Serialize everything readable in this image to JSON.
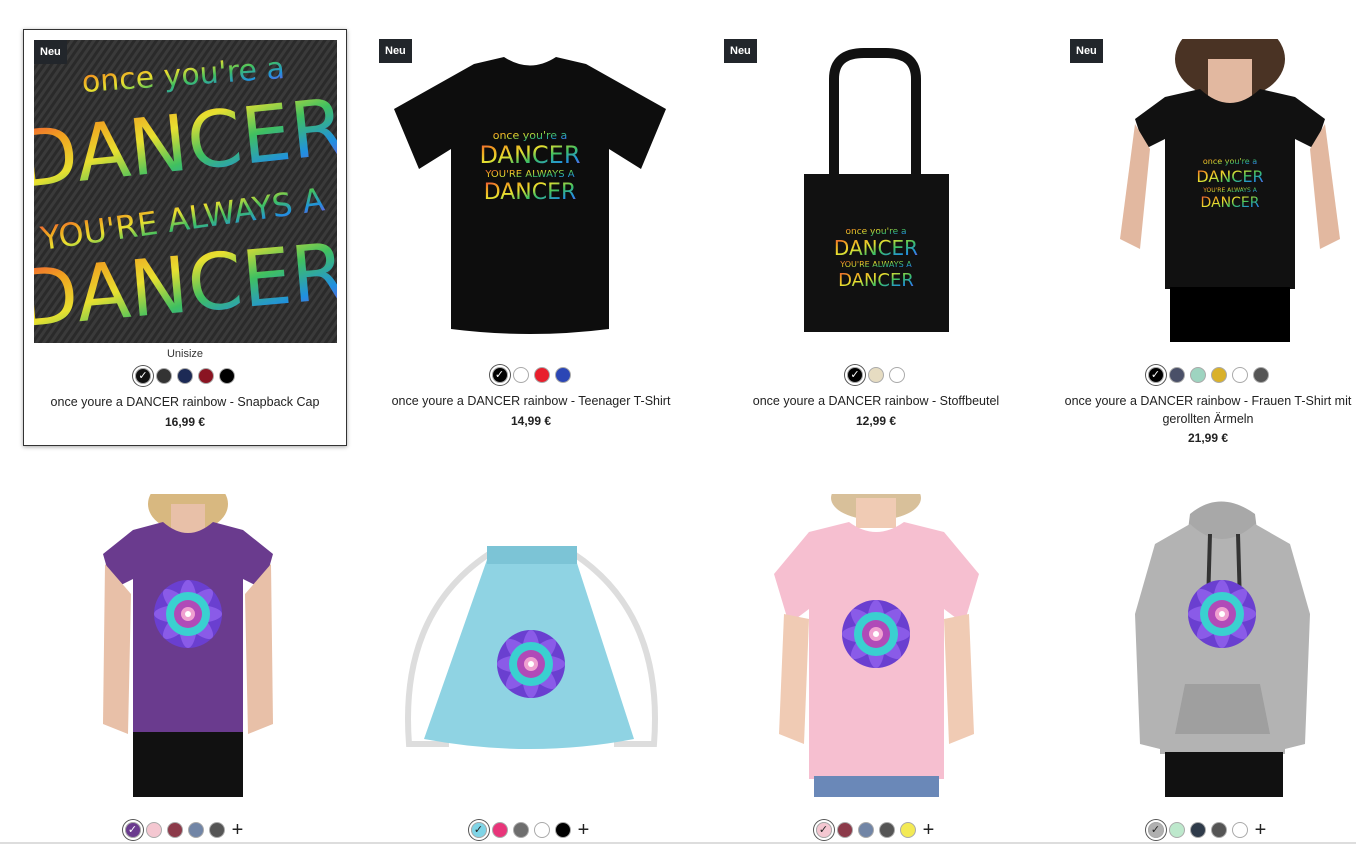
{
  "badge_label": "Neu",
  "row1": [
    {
      "title": "once youre a DANCER rainbow - Snapback Cap",
      "price": "16,99 €",
      "size_label": "Unisize",
      "product": "cap",
      "swatches": [
        "#111111",
        "#333333",
        "#1c2a55",
        "#8a1422",
        "#000000"
      ],
      "selected": 0
    },
    {
      "title": "once youre a DANCER rainbow - Teenager T-Shirt",
      "price": "14,99 €",
      "product": "teen-tshirt",
      "swatches": [
        "#000000",
        "#ffffff",
        "#e81e2c",
        "#2b46b5"
      ],
      "selected": 0
    },
    {
      "title": "once youre a DANCER rainbow - Stoffbeutel",
      "price": "12,99 €",
      "product": "tote-bag",
      "swatches": [
        "#000000",
        "#e6dcc2",
        "#ffffff"
      ],
      "selected": 0
    },
    {
      "title": "once youre a DANCER rainbow - Frauen T-Shirt mit gerollten Ärmeln",
      "price": "21,99 €",
      "product": "women-rolled-tshirt",
      "swatches": [
        "#000000",
        "#4a5068",
        "#9ed4c0",
        "#d9b12b",
        "#ffffff",
        "#555555"
      ],
      "selected": 0
    }
  ],
  "row2": [
    {
      "product": "women-purple-tshirt",
      "swatches": [
        "#6a3b8e",
        "#f4c7d1",
        "#8c3a4a",
        "#7185a6",
        "#555555"
      ],
      "selected": 0,
      "more": "+"
    },
    {
      "product": "gym-bag",
      "swatches": [
        "#7fd4e6",
        "#e8357a",
        "#6e6e6e",
        "#ffffff",
        "#000000"
      ],
      "selected": 0,
      "more": "+"
    },
    {
      "product": "kids-pink-tshirt",
      "swatches": [
        "#f4c7d1",
        "#8c3a4a",
        "#7185a6",
        "#555555",
        "#f3ea55"
      ],
      "selected": 0,
      "more": "+"
    },
    {
      "product": "women-hoodie",
      "swatches": [
        "#b0b0b0",
        "#bde8cc",
        "#2f3b4a",
        "#555555",
        "#ffffff"
      ],
      "selected": 0,
      "more": "+"
    }
  ],
  "design_text": {
    "line1": "once you're a",
    "line2": "DANCER",
    "line3": "YOU'RE ALWAYS A",
    "line4": "DANCER"
  }
}
